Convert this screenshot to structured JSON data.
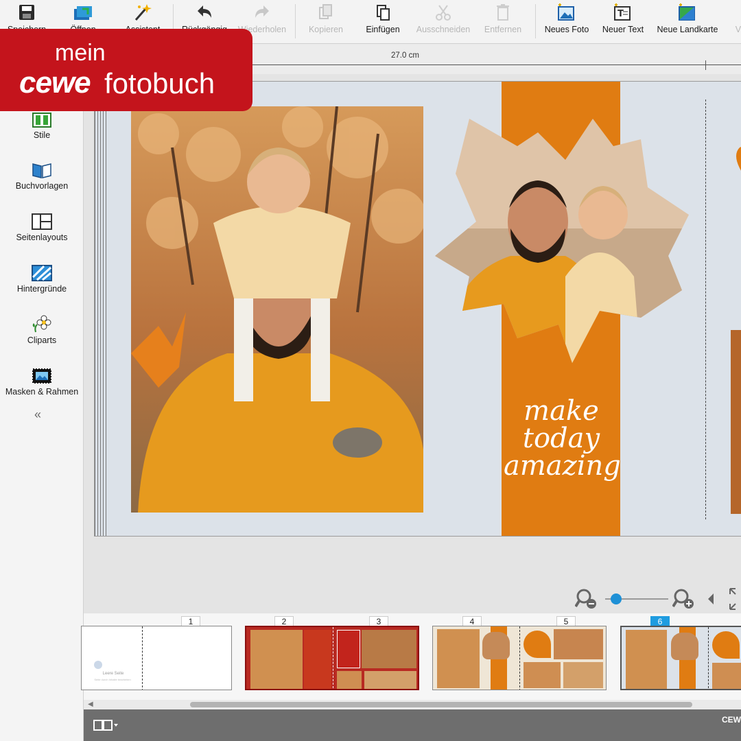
{
  "toolbar": {
    "items": [
      {
        "label": "Speichern",
        "icon": "save-icon",
        "enabled": true
      },
      {
        "label": "Öffnen",
        "icon": "open-icon",
        "enabled": true
      },
      {
        "label": "Assistent",
        "icon": "wizard-icon",
        "enabled": true
      },
      {
        "label": "Rückgängig",
        "icon": "undo-icon",
        "enabled": true
      },
      {
        "label": "Wiederholen",
        "icon": "redo-icon",
        "enabled": false
      },
      {
        "label": "Kopieren",
        "icon": "copy-icon",
        "enabled": false
      },
      {
        "label": "Einfügen",
        "icon": "paste-icon",
        "enabled": true
      },
      {
        "label": "Ausschneiden",
        "icon": "cut-icon",
        "enabled": false
      },
      {
        "label": "Entfernen",
        "icon": "trash-icon",
        "enabled": false
      },
      {
        "label": "Neues Foto",
        "icon": "new-photo-icon",
        "enabled": true
      },
      {
        "label": "Neuer Text",
        "icon": "new-text-icon",
        "enabled": true
      },
      {
        "label": "Neue Landkarte",
        "icon": "new-map-icon",
        "enabled": true
      },
      {
        "label": "Ve",
        "icon": "",
        "enabled": false
      }
    ]
  },
  "brand": {
    "line1": "mein",
    "logo": "cewe",
    "line2": "fotobuch",
    "color": "#c4141c"
  },
  "sidebar": {
    "items": [
      {
        "label": "Stile",
        "icon": "styles-icon"
      },
      {
        "label": "Buchvorlagen",
        "icon": "book-templates-icon"
      },
      {
        "label": "Seitenlayouts",
        "icon": "page-layouts-icon"
      },
      {
        "label": "Hintergründe",
        "icon": "backgrounds-icon"
      },
      {
        "label": "Cliparts",
        "icon": "cliparts-icon"
      },
      {
        "label": "Masken & Rahmen",
        "icon": "masks-frames-icon"
      }
    ],
    "collapse_label": "«"
  },
  "ruler": {
    "width_label": "27.0 cm"
  },
  "spread": {
    "quote_line1": "make",
    "quote_line2": "today",
    "quote_line3": "amazing",
    "stripe_color": "#e07c12",
    "background_color": "#dce2e9"
  },
  "zoom": {
    "level": 0.1
  },
  "filmstrip": {
    "pages": [
      "1",
      "2",
      "3",
      "4",
      "5",
      "6"
    ],
    "active_page": "6",
    "empty_page_label": "Leere Seite",
    "empty_page_hint": "Seite durch Inhalte bearbeiten"
  },
  "bottombar": {
    "label": "CEW"
  }
}
